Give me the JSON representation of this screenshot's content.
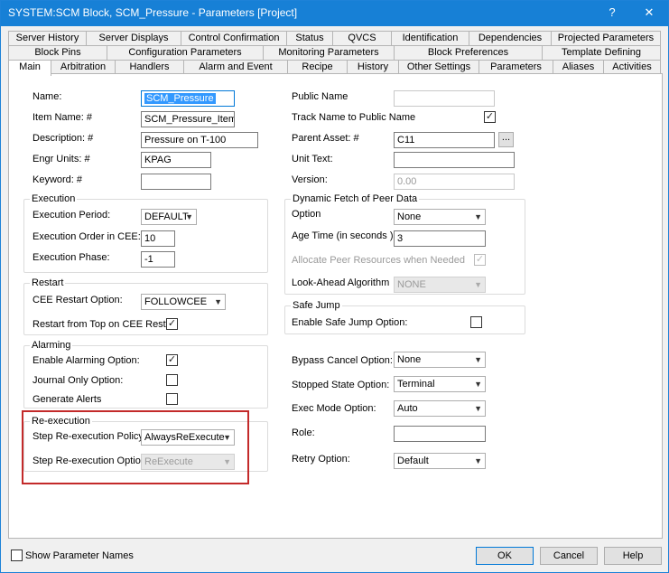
{
  "window": {
    "title": "SYSTEM:SCM Block, SCM_Pressure - Parameters [Project]",
    "help_glyph": "?",
    "close_glyph": "✕"
  },
  "tabs": {
    "row1": [
      "Server History",
      "Server Displays",
      "Control Confirmation",
      "Status",
      "QVCS",
      "Identification",
      "Dependencies",
      "Projected Parameters"
    ],
    "row2": [
      "Block Pins",
      "Configuration Parameters",
      "Monitoring Parameters",
      "Block Preferences",
      "Template Defining"
    ],
    "row3": [
      "Main",
      "Arbitration",
      "Handlers",
      "Alarm and Event",
      "Recipe",
      "History",
      "Other Settings",
      "Parameters",
      "Aliases",
      "Activities"
    ],
    "active": "Main"
  },
  "left": {
    "name_label": "Name:",
    "name_value": "SCM_Pressure",
    "item_name_label": "Item Name: #",
    "item_name_value": "SCM_Pressure_Item",
    "description_label": "Description: #",
    "description_value": "Pressure on T-100",
    "engr_units_label": "Engr Units: #",
    "engr_units_value": "KPAG",
    "keyword_label": "Keyword: #",
    "keyword_value": ""
  },
  "execution": {
    "title": "Execution",
    "period_label": "Execution Period:",
    "period_value": "DEFAULT",
    "order_label": "Execution Order in CEE:",
    "order_value": "10",
    "phase_label": "Execution Phase:",
    "phase_value": "-1"
  },
  "restart": {
    "title": "Restart",
    "cee_label": "CEE Restart Option:",
    "cee_value": "FOLLOWCEE",
    "from_top_label": "Restart from Top on CEE Restart",
    "from_top_checked": true
  },
  "alarming": {
    "title": "Alarming",
    "enable_label": "Enable Alarming Option:",
    "enable_checked": true,
    "journal_label": "Journal Only Option:",
    "journal_checked": false,
    "generate_label": "Generate Alerts",
    "generate_checked": false
  },
  "reexecution": {
    "title": "Re-execution",
    "policy_label": "Step Re-execution Policy:",
    "policy_value": "AlwaysReExecute",
    "option_label": "Step Re-execution Option:",
    "option_value": "ReExecute"
  },
  "right": {
    "public_name_label": "Public Name",
    "public_name_value": "",
    "track_label": "Track Name to Public Name",
    "track_checked": true,
    "parent_asset_label": "Parent Asset: #",
    "parent_asset_value": "C11",
    "parent_browse": "...",
    "unit_text_label": "Unit Text:",
    "unit_text_value": "",
    "version_label": "Version:",
    "version_value": "0.00"
  },
  "peer": {
    "title": "Dynamic Fetch of Peer Data",
    "option_label": "Option",
    "option_value": "None",
    "age_label": "Age Time (in seconds )",
    "age_value": "3",
    "allocate_label": "Allocate Peer Resources when Needed",
    "allocate_checked": true,
    "lookahead_label": "Look-Ahead Algorithm",
    "lookahead_value": "NONE"
  },
  "safe_jump": {
    "title": "Safe Jump",
    "enable_label": "Enable Safe Jump Option:",
    "enable_checked": false
  },
  "options": {
    "bypass_label": "Bypass Cancel Option:",
    "bypass_value": "None",
    "stopped_label": "Stopped State Option:",
    "stopped_value": "Terminal",
    "exec_mode_label": "Exec Mode Option:",
    "exec_mode_value": "Auto",
    "role_label": "Role:",
    "role_value": "",
    "retry_label": "Retry Option:",
    "retry_value": "Default"
  },
  "footer": {
    "show_param_names_label": "Show Parameter Names",
    "show_param_names_checked": false,
    "ok": "OK",
    "cancel": "Cancel",
    "help": "Help"
  },
  "glyphs": {
    "check": "✓",
    "dropdown": "▼"
  }
}
